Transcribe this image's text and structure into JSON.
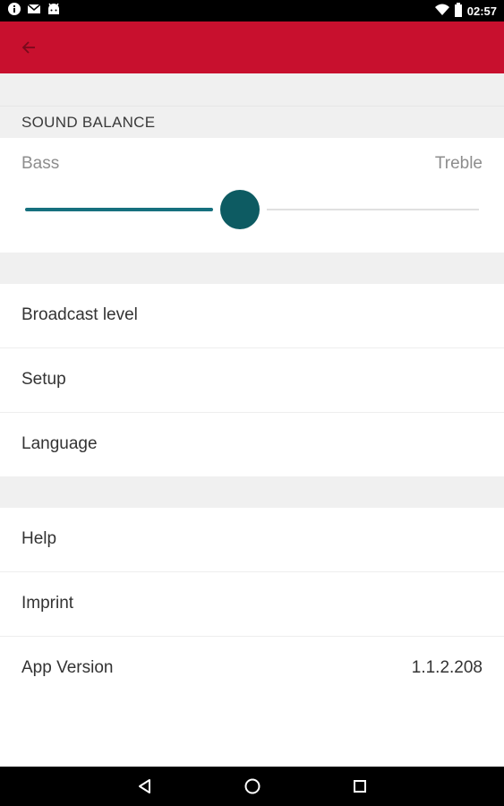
{
  "status_bar": {
    "time": "02:57",
    "left_icons": [
      "info-icon",
      "mail-icon",
      "android-icon"
    ],
    "right_icons": [
      "wifi-icon",
      "battery-icon"
    ]
  },
  "toolbar": {
    "back_icon": "arrow-left-icon",
    "color": "#c8102e"
  },
  "sound_balance": {
    "header": "SOUND BALANCE",
    "bass_label": "Bass",
    "treble_label": "Treble",
    "slider_value_fraction": 0.47,
    "accent_color": "#0d5b62"
  },
  "group1": [
    {
      "label": "Broadcast level"
    },
    {
      "label": "Setup"
    },
    {
      "label": "Language"
    }
  ],
  "group2": [
    {
      "label": "Help"
    },
    {
      "label": "Imprint"
    },
    {
      "label": "App Version",
      "value": "1.1.2.208"
    }
  ],
  "nav_bar": {
    "icons": [
      "back-triangle-icon",
      "home-circle-icon",
      "recents-square-icon"
    ]
  }
}
